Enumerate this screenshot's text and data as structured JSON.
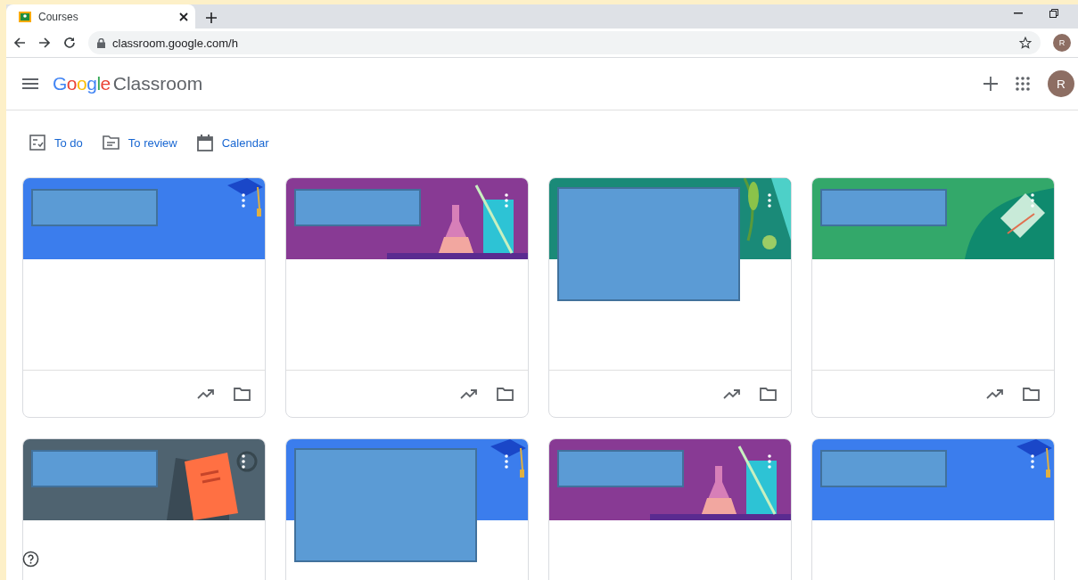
{
  "browser": {
    "tab_title": "Courses",
    "url": "classroom.google.com/h",
    "profile_initial": "R"
  },
  "app": {
    "logo_google": "Google",
    "logo_product": "Classroom",
    "account_initial": "R"
  },
  "nav": [
    {
      "kind": "todo",
      "label": "To do"
    },
    {
      "kind": "review",
      "label": "To review"
    },
    {
      "kind": "calendar",
      "label": "Calendar"
    }
  ],
  "courses": [
    {
      "color": "#3b7ded",
      "kind": "cap",
      "large_cover": false
    },
    {
      "color": "#883a94",
      "kind": "flask",
      "large_cover": false
    },
    {
      "color": "#1a8a78",
      "kind": "leaf",
      "large_cover": true
    },
    {
      "color": "#33a86a",
      "kind": "book",
      "large_cover": false
    },
    {
      "color": "#4f6370",
      "kind": "notebook",
      "large_cover": false
    },
    {
      "color": "#3b7ded",
      "kind": "cap",
      "large_cover": true
    },
    {
      "color": "#883a94",
      "kind": "flask",
      "large_cover": false
    },
    {
      "color": "#3b7ded",
      "kind": "cap",
      "large_cover": false
    }
  ]
}
